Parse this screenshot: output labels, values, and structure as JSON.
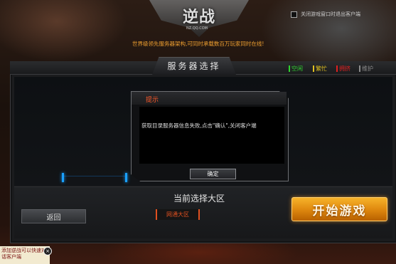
{
  "header": {
    "logo_text": "逆战",
    "logo_sub": "NZ.QQ.COM",
    "top_checkbox_label": "关闭游戏窗口时退出客户端",
    "notice": "世界级领先服务器架构,可同时承载数百万玩家同时在线!"
  },
  "panel": {
    "title": "服务器选择",
    "legend": [
      {
        "label": "空闲",
        "color": "#2fd12f"
      },
      {
        "label": "繁忙",
        "color": "#e0c020"
      },
      {
        "label": "拥挤",
        "color": "#e02020"
      },
      {
        "label": "维护",
        "color": "#8c8c8c"
      }
    ]
  },
  "dialog": {
    "title": "提示",
    "message": "获取目录服务器信息失败,点击\"确认\",关闭客户端",
    "ok_label": "确定"
  },
  "footer": {
    "current_zone_label": "当前选择大区",
    "back_label": "返回",
    "zone_name": "网通大区",
    "start_label": "开始游戏"
  },
  "side_note": {
    "text": "添加逆战可以快速对话客户端",
    "close": "×"
  },
  "colors": {
    "accent_orange": "#f0a030",
    "alert_red": "#ff5a2a",
    "cyan": "#1aa0ff"
  }
}
